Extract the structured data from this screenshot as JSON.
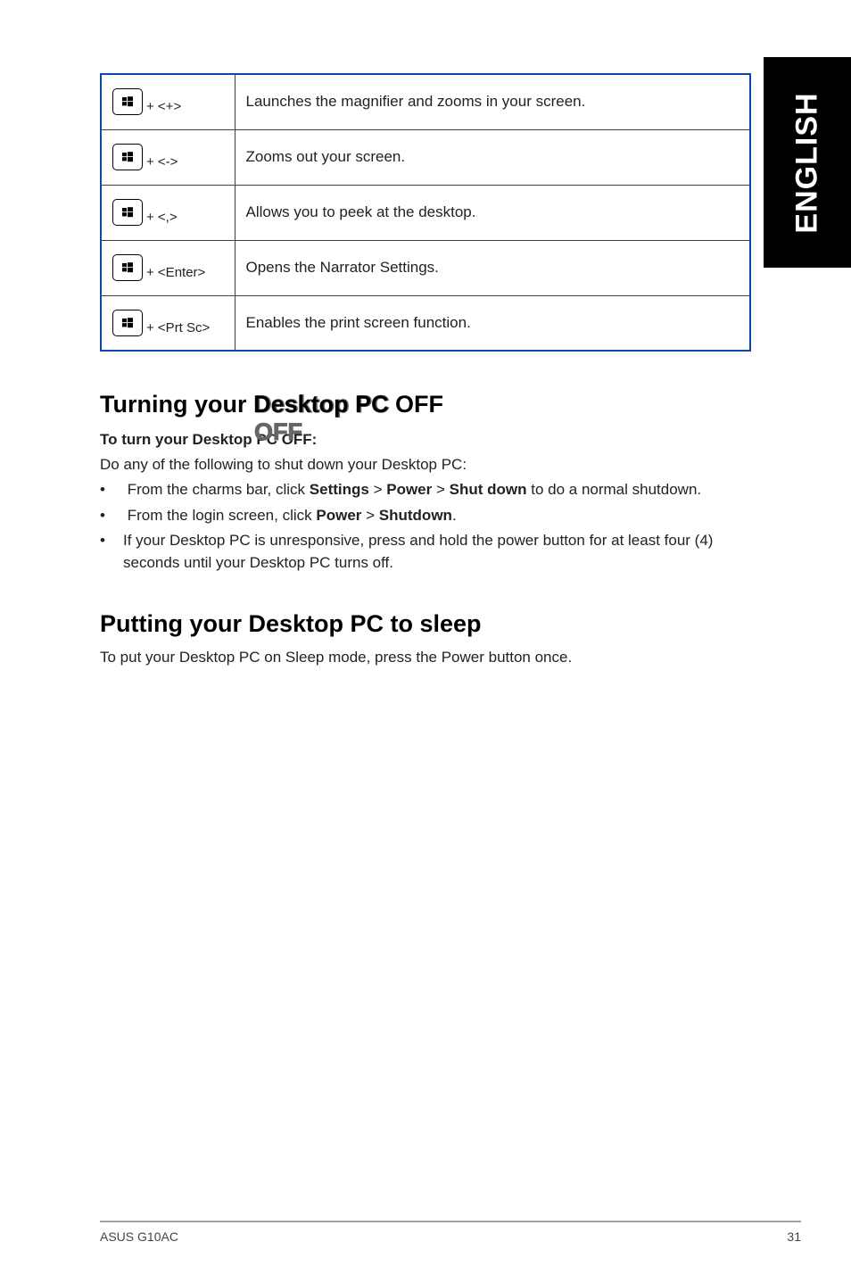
{
  "sideTab": "ENGLISH",
  "shortcuts": [
    {
      "combo": "+ <+>",
      "desc": "Launches the magnifier and zooms in your screen."
    },
    {
      "combo": "+ <->",
      "desc": "Zooms out your screen."
    },
    {
      "combo": "+ <,>",
      "desc": "Allows you to peek at the desktop."
    },
    {
      "combo": "+ <Enter>",
      "desc": "Opens the Narrator Settings."
    },
    {
      "combo": "+ <Prt Sc>",
      "desc": "Enables the print screen function."
    }
  ],
  "sectionOff": {
    "titlePrefix": "Turning your ",
    "titleBold": "Desktop PC OFF",
    "sub": "To turn your Desktop PC OFF:",
    "lead": "Do any of the following to shut down your Desktop PC:",
    "b1a": "From the charms bar, click ",
    "b1s": "Settings",
    "b1gt1": " > ",
    "b1p": "Power",
    "b1gt2": " > ",
    "b1sd": "Shut down",
    "b1end": " to do a normal shutdown.",
    "b2a": "From the login screen, click ",
    "b2p": "Power",
    "b2gt": " > ",
    "b2sd": "Shutdown",
    "b2end": ".",
    "b3": "If your Desktop PC is unresponsive, press and hold the power  button for at least four (4) seconds until your Desktop PC turns off."
  },
  "sectionSleep": {
    "title": "Putting your Desktop PC to sleep",
    "body": "To put your Desktop PC on Sleep mode, press the Power button once."
  },
  "footer": {
    "left": "ASUS G10AC",
    "right": "31"
  }
}
